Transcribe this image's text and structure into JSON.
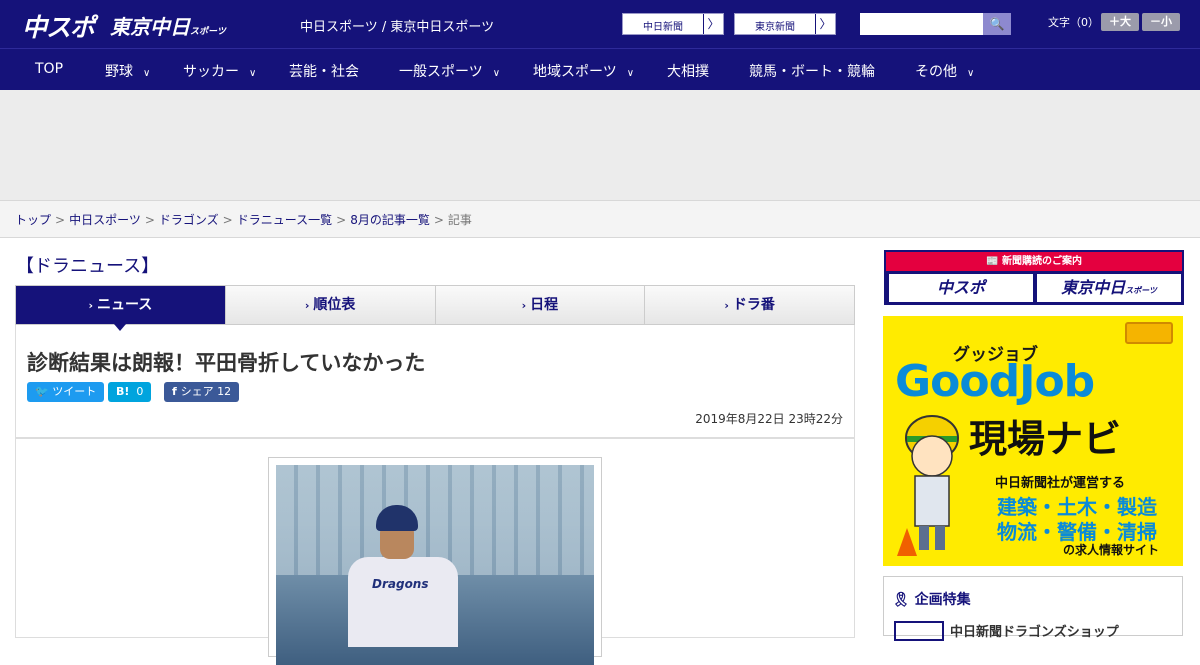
{
  "header": {
    "logo_main": "中スポ",
    "logo_sub": "東京中日",
    "logo_sub_small": "スポーツ",
    "site_name": "中日スポーツ / 東京中日スポーツ",
    "paper_buttons": [
      {
        "label": "中日新聞",
        "arrow": "〉"
      },
      {
        "label": "東京新聞",
        "arrow": "〉"
      }
    ],
    "search_icon": "🔍",
    "font_size_label": "文字（0）",
    "font_bigger": "＋大",
    "font_smaller": "－小"
  },
  "nav": {
    "items": [
      {
        "label": "TOP",
        "chev": ""
      },
      {
        "label": "野球",
        "chev": "∨"
      },
      {
        "label": "サッカー",
        "chev": "∨"
      },
      {
        "label": "芸能・社会",
        "chev": ""
      },
      {
        "label": "一般スポーツ",
        "chev": "∨"
      },
      {
        "label": "地域スポーツ",
        "chev": "∨"
      },
      {
        "label": "大相撲",
        "chev": ""
      },
      {
        "label": "競馬・ボート・競輪",
        "chev": ""
      },
      {
        "label": "その他",
        "chev": "∨"
      }
    ]
  },
  "breadcrumb": {
    "items": [
      "トップ",
      "中日スポーツ",
      "ドラゴンズ",
      "ドラニュース一覧",
      "8月の記事一覧"
    ],
    "sep": ">",
    "current": "記事"
  },
  "section_title": "【ドラニュース】",
  "tabs": [
    {
      "label": "ニュース",
      "chev": "›"
    },
    {
      "label": "順位表",
      "chev": "›"
    },
    {
      "label": "日程",
      "chev": "›"
    },
    {
      "label": "ドラ番",
      "chev": "›"
    }
  ],
  "article": {
    "headline": "診断結果は朗報！平田骨折していなかった",
    "date": "2019年8月22日 23時22分",
    "share": {
      "tweet": "ツイート",
      "hatena_label": "B!",
      "hatena_count": "0",
      "facebook_label": "シェア",
      "facebook_count": "12"
    },
    "photo_jersey": "Dragons"
  },
  "sidebar": {
    "subscribe_head": "新聞購読のご案内",
    "subscribe_buttons": [
      "中スポ",
      "東京中日"
    ],
    "subscribe_small": "スポーツ",
    "ad": {
      "kana": "グッジョブ",
      "title": "GoodJob",
      "navi": "現場ナビ",
      "line1": "中日新聞社が運営する",
      "line2": "建築・土木・製造",
      "line3": "物流・警備・清掃",
      "line4": "の求人情報サイト"
    },
    "feature_head": "企画特集",
    "feature_item": "中日新聞ドラゴンズショップ"
  },
  "colors": {
    "brand": "#15127a",
    "accent_red": "#e4003f",
    "twitter": "#1d9bf0",
    "hatena": "#00a4de",
    "facebook": "#3b5998",
    "ad_yellow": "#ffeb00"
  }
}
